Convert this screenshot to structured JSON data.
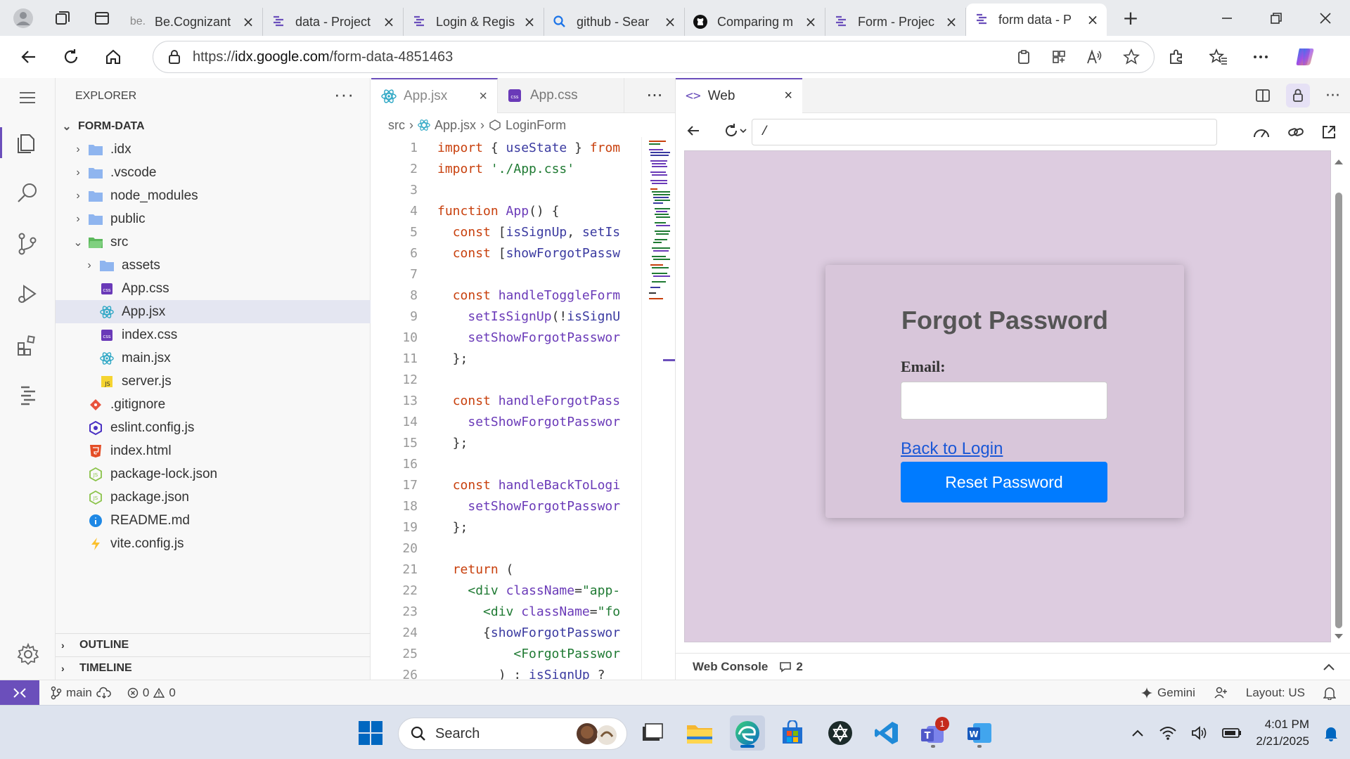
{
  "browser": {
    "tabs": [
      {
        "title": "Be.Cognizant",
        "prefix": "be.",
        "icon": "becognizant-icon"
      },
      {
        "title": "data - Project",
        "icon": "idx-icon"
      },
      {
        "title": "Login & Regis",
        "icon": "idx-icon"
      },
      {
        "title": "github - Sear",
        "icon": "search-icon"
      },
      {
        "title": "Comparing m",
        "icon": "github-icon"
      },
      {
        "title": "Form - Projec",
        "icon": "idx-icon"
      },
      {
        "title": "form data - P",
        "icon": "idx-icon",
        "active": true
      }
    ],
    "url_prefix": "https://",
    "url_domain": "idx.google.com",
    "url_path": "/form-data-4851463"
  },
  "explorer": {
    "title": "EXPLORER",
    "root": "FORM-DATA",
    "items": [
      {
        "label": ".idx",
        "type": "folder",
        "depth": 1
      },
      {
        "label": ".vscode",
        "type": "folder",
        "depth": 1
      },
      {
        "label": "node_modules",
        "type": "folder",
        "depth": 1
      },
      {
        "label": "public",
        "type": "folder",
        "depth": 1
      },
      {
        "label": "src",
        "type": "folder-open",
        "depth": 1
      },
      {
        "label": "assets",
        "type": "folder",
        "depth": 2
      },
      {
        "label": "App.css",
        "type": "css",
        "depth": 2
      },
      {
        "label": "App.jsx",
        "type": "react",
        "depth": 2,
        "selected": true
      },
      {
        "label": "index.css",
        "type": "css",
        "depth": 2
      },
      {
        "label": "main.jsx",
        "type": "react",
        "depth": 2
      },
      {
        "label": "server.js",
        "type": "js",
        "depth": 2
      },
      {
        "label": ".gitignore",
        "type": "git",
        "depth": 1
      },
      {
        "label": "eslint.config.js",
        "type": "eslint",
        "depth": 1
      },
      {
        "label": "index.html",
        "type": "html",
        "depth": 1
      },
      {
        "label": "package-lock.json",
        "type": "npm",
        "depth": 1
      },
      {
        "label": "package.json",
        "type": "npm",
        "depth": 1
      },
      {
        "label": "README.md",
        "type": "info",
        "depth": 1
      },
      {
        "label": "vite.config.js",
        "type": "vite",
        "depth": 1
      }
    ],
    "outline": "OUTLINE",
    "timeline": "TIMELINE"
  },
  "editor": {
    "tabs": [
      {
        "label": "App.jsx",
        "active": true
      },
      {
        "label": "App.css",
        "active": false
      }
    ],
    "breadcrumb": [
      "src",
      "App.jsx",
      "LoginForm"
    ],
    "lines": [
      [
        [
          "kw",
          "import"
        ],
        [
          "pu",
          " { "
        ],
        [
          "vr",
          "useState"
        ],
        [
          "pu",
          " } "
        ],
        [
          "kw",
          "from"
        ]
      ],
      [
        [
          "kw",
          "import"
        ],
        [
          "pu",
          " "
        ],
        [
          "str",
          "'./App.css'"
        ]
      ],
      [],
      [
        [
          "kw",
          "function"
        ],
        [
          "pu",
          " "
        ],
        [
          "fn",
          "App"
        ],
        [
          "pu",
          "() {"
        ]
      ],
      [
        [
          "pu",
          "  "
        ],
        [
          "kw",
          "const"
        ],
        [
          "pu",
          " ["
        ],
        [
          "vr",
          "isSignUp"
        ],
        [
          "pu",
          ", "
        ],
        [
          "vr",
          "setIs"
        ]
      ],
      [
        [
          "pu",
          "  "
        ],
        [
          "kw",
          "const"
        ],
        [
          "pu",
          " ["
        ],
        [
          "vr",
          "showForgotPassw"
        ]
      ],
      [],
      [
        [
          "pu",
          "  "
        ],
        [
          "kw",
          "const"
        ],
        [
          "pu",
          " "
        ],
        [
          "fn",
          "handleToggleForm"
        ]
      ],
      [
        [
          "pu",
          "    "
        ],
        [
          "fn",
          "setIsSignUp"
        ],
        [
          "pu",
          "(!"
        ],
        [
          "vr",
          "isSignU"
        ]
      ],
      [
        [
          "pu",
          "    "
        ],
        [
          "fn",
          "setShowForgotPasswor"
        ]
      ],
      [
        [
          "pu",
          "  };"
        ]
      ],
      [],
      [
        [
          "pu",
          "  "
        ],
        [
          "kw",
          "const"
        ],
        [
          "pu",
          " "
        ],
        [
          "fn",
          "handleForgotPass"
        ]
      ],
      [
        [
          "pu",
          "    "
        ],
        [
          "fn",
          "setShowForgotPasswor"
        ]
      ],
      [
        [
          "pu",
          "  };"
        ]
      ],
      [],
      [
        [
          "pu",
          "  "
        ],
        [
          "kw",
          "const"
        ],
        [
          "pu",
          " "
        ],
        [
          "fn",
          "handleBackToLogi"
        ]
      ],
      [
        [
          "pu",
          "    "
        ],
        [
          "fn",
          "setShowForgotPasswor"
        ]
      ],
      [
        [
          "pu",
          "  };"
        ]
      ],
      [],
      [
        [
          "pu",
          "  "
        ],
        [
          "kw",
          "return"
        ],
        [
          "pu",
          " ("
        ]
      ],
      [
        [
          "pu",
          "    "
        ],
        [
          "tg",
          "<div"
        ],
        [
          "pu",
          " "
        ],
        [
          "at",
          "className"
        ],
        [
          "pu",
          "="
        ],
        [
          "str",
          "\"app-"
        ]
      ],
      [
        [
          "pu",
          "      "
        ],
        [
          "tg",
          "<div"
        ],
        [
          "pu",
          " "
        ],
        [
          "at",
          "className"
        ],
        [
          "pu",
          "="
        ],
        [
          "str",
          "\"fo"
        ]
      ],
      [
        [
          "pu",
          "      {"
        ],
        [
          "vr",
          "showForgotPasswor"
        ]
      ],
      [
        [
          "pu",
          "          "
        ],
        [
          "tg",
          "<ForgotPasswor"
        ]
      ],
      [
        [
          "pu",
          "        ) : "
        ],
        [
          "vr",
          "isSignUp"
        ],
        [
          "pu",
          " ?"
        ]
      ]
    ]
  },
  "preview": {
    "tab": "Web",
    "path": "/",
    "form": {
      "title": "Forgot Password",
      "email_label": "Email:",
      "back_link": "Back to Login",
      "button": "Reset Password"
    },
    "console_label": "Web Console",
    "console_count": "2"
  },
  "statusbar": {
    "branch": "main",
    "errors": "0",
    "warnings": "0",
    "gemini": "Gemini",
    "layout": "Layout: US"
  },
  "taskbar": {
    "search_label": "Search",
    "teams_badge": "1",
    "time": "4:01 PM",
    "date": "2/21/2025"
  },
  "colors": {
    "accent": "#6b4fbb",
    "preview_bg": "#ddcce0",
    "card_bg": "#d8c6da",
    "button_blue": "#007bff",
    "link_blue": "#1a57d6"
  }
}
